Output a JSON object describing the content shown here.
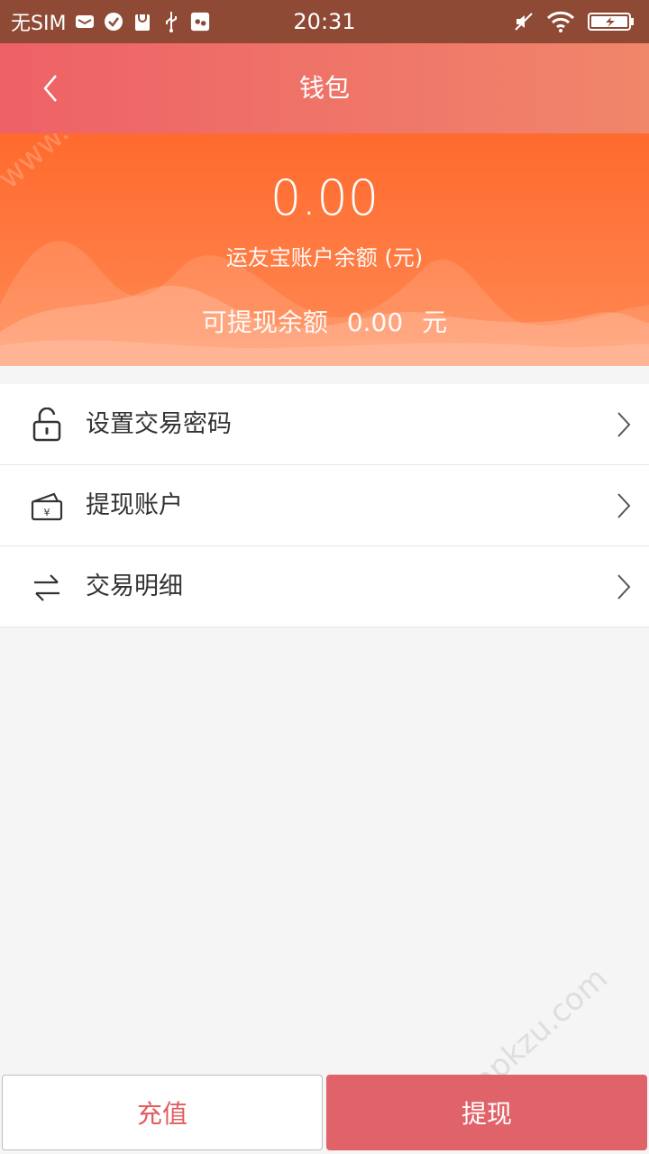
{
  "status_bar": {
    "carrier": "无SIM",
    "time": "20:31"
  },
  "header": {
    "title": "钱包"
  },
  "balance": {
    "amount": "0.00",
    "label": "运友宝账户余额 (元)",
    "withdrawable_label": "可提现余额",
    "withdrawable_amount": "0.00",
    "withdrawable_unit": "元"
  },
  "menu": {
    "items": [
      {
        "label": "设置交易密码",
        "icon": "lock-icon"
      },
      {
        "label": "提现账户",
        "icon": "card-icon"
      },
      {
        "label": "交易明细",
        "icon": "transfer-icon"
      }
    ]
  },
  "actions": {
    "recharge": "充值",
    "withdraw": "提现"
  },
  "watermark": "www.apkzu.com",
  "colors": {
    "accent": "#e0636a",
    "balance_bg": "#ff6a2d"
  }
}
